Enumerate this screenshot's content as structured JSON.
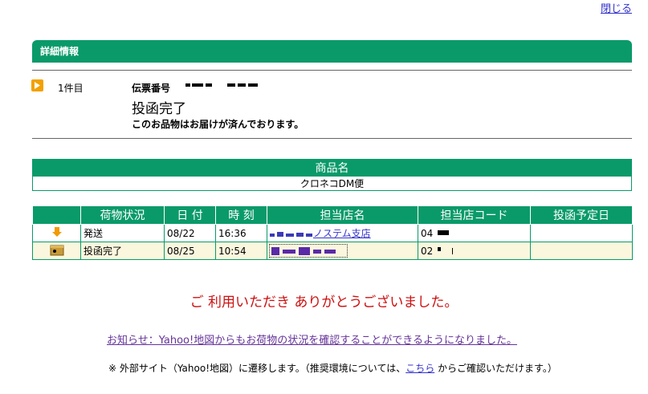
{
  "close_label": "閉じる",
  "section_title": "詳細情報",
  "item": {
    "count_label": "1件目",
    "slip_label": "伝票番号",
    "status": "投函完了",
    "message": "このお品物はお届けが済んでおります。"
  },
  "product": {
    "header": "商品名",
    "value": "クロネコDM便"
  },
  "tracking": {
    "headers": [
      "荷物状況",
      "日 付",
      "時 刻",
      "担当店名",
      "担当店コード",
      "投函予定日"
    ],
    "rows": [
      {
        "icon": "down-arrow-icon",
        "status": "発送",
        "date": "08/22",
        "time": "16:36",
        "store": "ノステム支店",
        "code": "04",
        "scheduled": ""
      },
      {
        "icon": "package-box-icon",
        "status": "投函完了",
        "date": "08/25",
        "time": "10:54",
        "store": "",
        "code": "02",
        "scheduled": ""
      }
    ]
  },
  "thanks": "ご 利用いただき ありがとうございました。",
  "notice": "お知らせ：Yahoo!地図からもお荷物の状況を確認することができるようになりました。",
  "footnote": {
    "before": "※ 外部サイト（Yahoo!地図）に遷移します。（推奨環境については、",
    "link": "こちら",
    "after": " からご確認いただけます。）"
  },
  "colors": {
    "header_green": "#0a9a6a",
    "thanks_red": "#cc1111",
    "notice_purple": "#663399"
  }
}
